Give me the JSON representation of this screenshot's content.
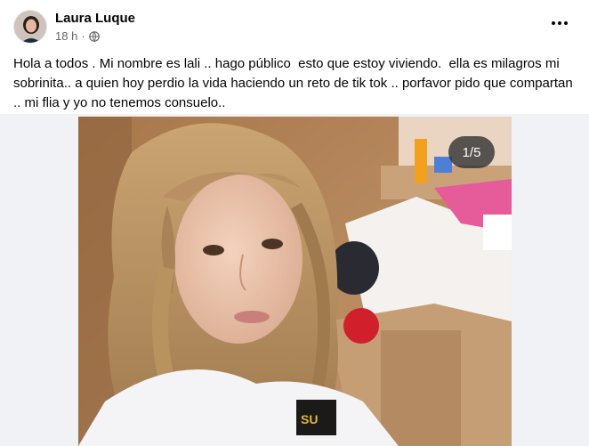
{
  "post": {
    "author": "Laura Luque",
    "time": "18 h",
    "separator": "·",
    "privacy_icon": "globe-icon",
    "more_icon": "more-options-icon",
    "text": "Hola a todos . Mi nombre es lali .. hago público  esto que estoy viviendo.  ella es milagros mi sobrinita.. a quien hoy perdio la vida haciendo un reto de tik tok .. porfavor pido que compartan .. mi flia y yo no tenemos consuelo.."
  },
  "photo": {
    "counter": "1/5",
    "badge_text": "SU"
  },
  "colors": {
    "text": "#050505",
    "secondary_text": "#65676b",
    "background": "#ffffff",
    "media_background": "#f0f2f5"
  }
}
